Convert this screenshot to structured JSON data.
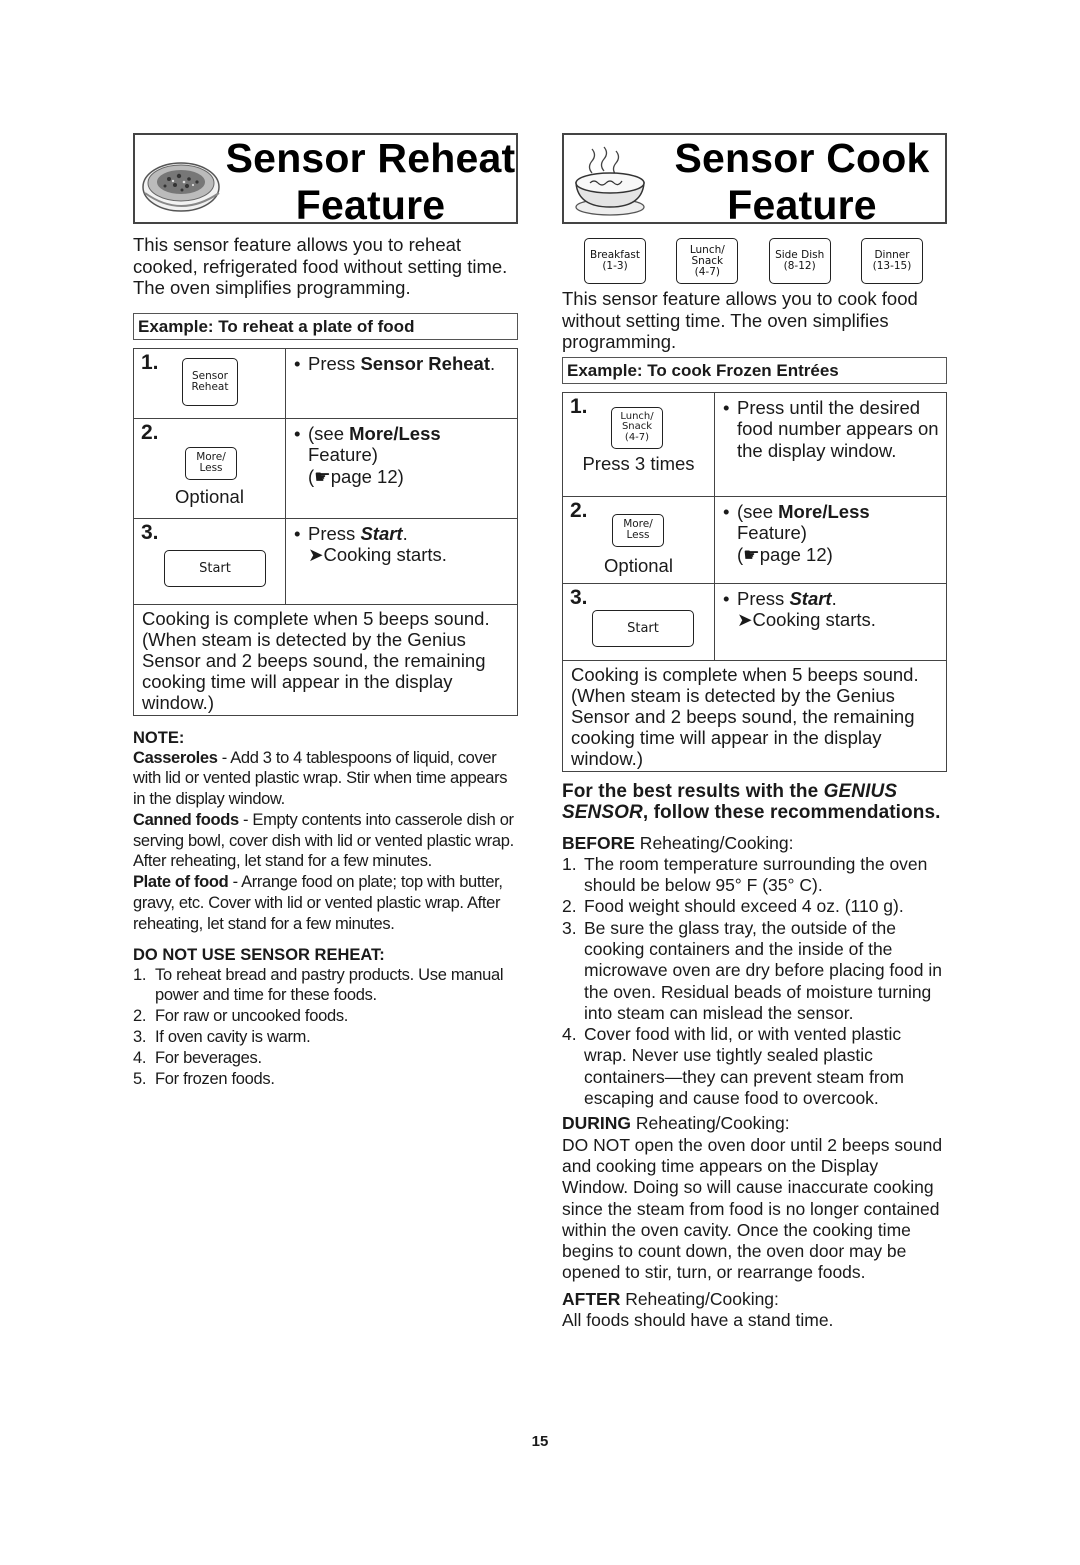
{
  "page_number": "15",
  "left": {
    "title_line1": "Sensor Reheat",
    "title_line2": "Feature",
    "illustration": "plate-of-food-illustration",
    "intro": "This sensor feature allows you to reheat cooked, refrigerated food without setting time. The oven simplifies programming.",
    "example": "Example: To reheat a plate of food",
    "steps": [
      {
        "num": "1.",
        "key_lines": [
          "Sensor",
          "Reheat"
        ],
        "caption": "",
        "text_pre": "Press ",
        "text_bold": "Sensor Reheat",
        "text_post": "."
      },
      {
        "num": "2.",
        "key_lines": [
          "More/",
          "Less"
        ],
        "caption": "Optional",
        "text_pre": "(see ",
        "text_bold": "More/Less",
        "text_line2": "Feature)",
        "text_line3": "(☛page 12)"
      },
      {
        "num": "3.",
        "key_lines": [
          "Start"
        ],
        "caption": "",
        "text_pre": "Press ",
        "text_bold": "Start",
        "text_post": ".",
        "text_line2": "➤Cooking starts."
      }
    ],
    "complete_text": "Cooking is complete when 5 beeps sound. (When steam is detected by the Genius Sensor and 2 beeps sound, the remaining cooking time will appear in the display window.)",
    "note_heading": "NOTE:",
    "notes": [
      {
        "bold": "Casseroles",
        "text": " - Add 3 to 4 tablespoons of liquid, cover with lid or vented plastic wrap. Stir when time appears in the display window."
      },
      {
        "bold": "Canned foods",
        "text": " - Empty contents into casserole dish or serving bowl, cover dish with lid or vented plastic wrap. After reheating, let stand for a few minutes."
      },
      {
        "bold": "Plate of food",
        "text": " - Arrange food on plate; top with butter, gravy, etc. Cover with lid or vented plastic wrap. After reheating, let stand for a few minutes."
      }
    ],
    "do_not_heading": "DO NOT USE SENSOR REHEAT:",
    "do_not_items": [
      {
        "n": "1.",
        "text": "To reheat bread and pastry products. Use manual power and time for these foods."
      },
      {
        "n": "2.",
        "text": "For raw or uncooked foods."
      },
      {
        "n": "3.",
        "text": "If oven cavity is warm."
      },
      {
        "n": "4.",
        "text": "For beverages."
      },
      {
        "n": "5.",
        "text": "For frozen foods."
      }
    ]
  },
  "right": {
    "title_line1": "Sensor Cook",
    "title_line2": "Feature",
    "illustration": "steaming-bowl-illustration",
    "keys": [
      {
        "line1": "Breakfast",
        "line2": "(1-3)",
        "line3": ""
      },
      {
        "line1": "Lunch/",
        "line2": "Snack",
        "line3": "(4-7)"
      },
      {
        "line1": "Side Dish",
        "line2": "(8-12)",
        "line3": ""
      },
      {
        "line1": "Dinner",
        "line2": "(13-15)",
        "line3": ""
      }
    ],
    "intro": "This sensor feature allows you to cook food without setting time. The oven simplifies programming.",
    "example": "Example: To cook Frozen Entrées",
    "steps": [
      {
        "num": "1.",
        "key_lines": [
          "Lunch/",
          "Snack",
          "(4-7)"
        ],
        "caption": "Press 3 times",
        "text": "Press until the desired food number appears on the display window."
      },
      {
        "num": "2.",
        "key_lines": [
          "More/",
          "Less"
        ],
        "caption": "Optional",
        "text_pre": "(see ",
        "text_bold": "More/Less",
        "text_line2": "Feature)",
        "text_line3": "(☛page 12)"
      },
      {
        "num": "3.",
        "key_lines": [
          "Start"
        ],
        "caption": "",
        "text_pre": "Press ",
        "text_bold": "Start",
        "text_post": ".",
        "text_line2": "➤Cooking starts."
      }
    ],
    "complete_text": "Cooking is complete when 5 beeps sound. (When steam is detected by the Genius Sensor and 2 beeps sound, the remaining cooking time will appear in the display window.)",
    "best_results": {
      "pre": "For the best results with the ",
      "italic": "GENIUS SENSOR",
      "post": ", follow these recommendations."
    },
    "before": {
      "label_bold": "BEFORE",
      "label_rest": " Reheating/Cooking:",
      "items": [
        {
          "n": "1.",
          "text": "The room temperature surrounding the oven should be below 95° F (35° C)."
        },
        {
          "n": "2.",
          "text": "Food weight should exceed 4 oz. (110 g)."
        },
        {
          "n": "3.",
          "text": "Be sure the glass tray, the outside of the cooking containers and the inside of the microwave oven are dry before placing food in the oven. Residual beads of moisture turning into steam can mislead the sensor."
        },
        {
          "n": "4.",
          "text": "Cover food with lid, or with vented plastic wrap. Never use tightly sealed plastic containers—they can prevent steam from escaping and cause food to overcook."
        }
      ]
    },
    "during": {
      "label_bold": "DURING",
      "label_rest": " Reheating/Cooking:",
      "text": "DO NOT open the oven door until 2 beeps sound and cooking time appears on the Display Window.  Doing so will cause inaccurate cooking since the steam from food is no longer contained within the oven cavity. Once the cooking time begins to count down, the oven door may be opened to stir, turn, or rearrange foods."
    },
    "after": {
      "label_bold": "AFTER",
      "label_rest": " Reheating/Cooking:",
      "text": "All foods should have a stand time."
    }
  }
}
